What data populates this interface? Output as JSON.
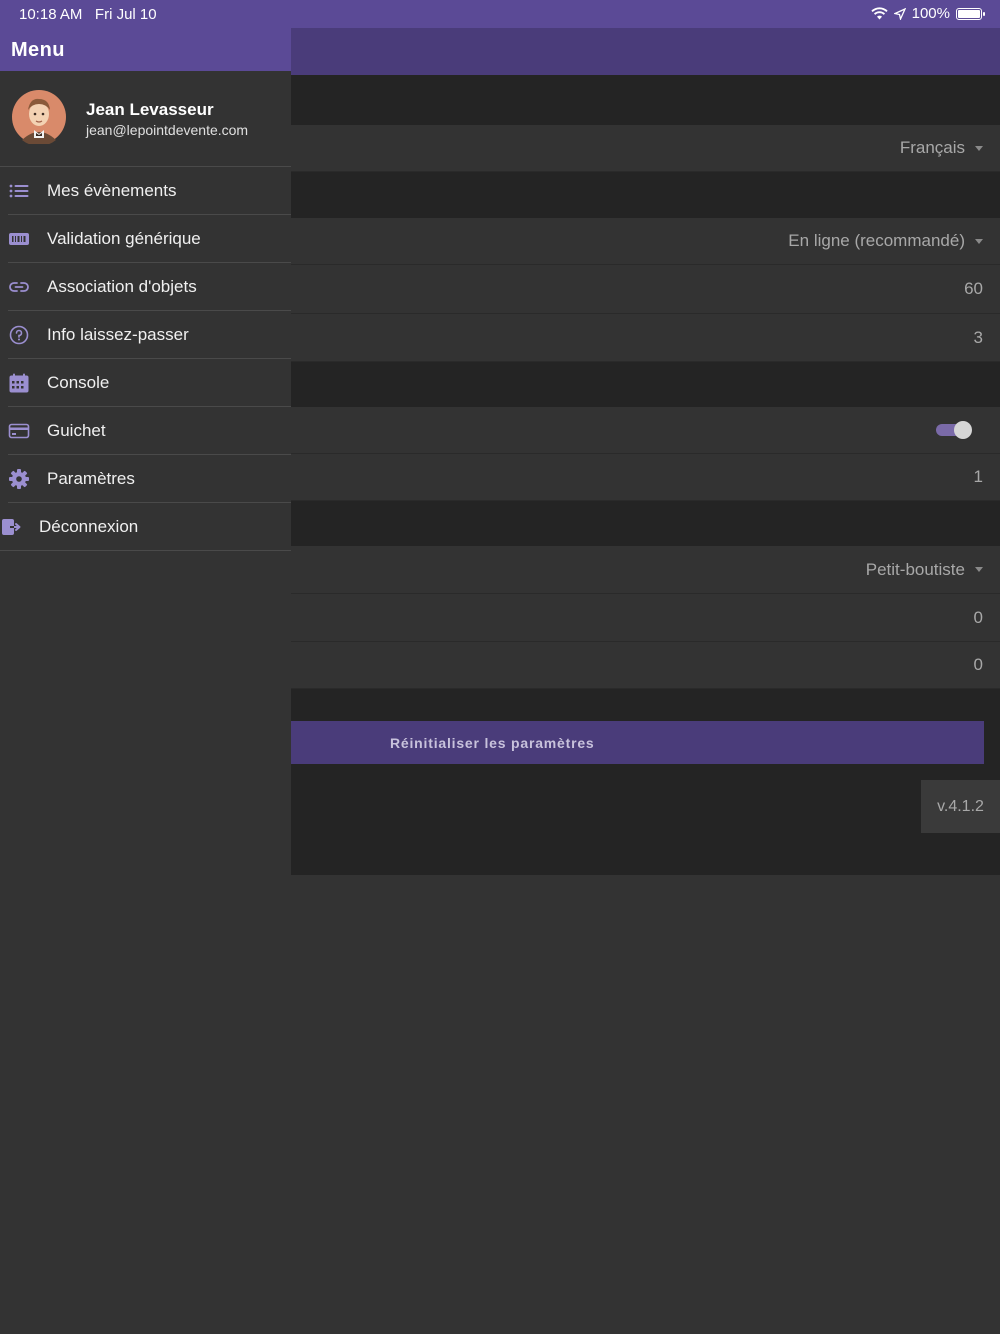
{
  "status_bar": {
    "time": "10:18 AM",
    "date": "Fri Jul 10",
    "battery": "100%"
  },
  "drawer": {
    "title": "Menu",
    "user": {
      "name": "Jean Levasseur",
      "email": "jean@lepointdevente.com"
    },
    "items": [
      {
        "label": "Mes évènements",
        "icon": "list-icon"
      },
      {
        "label": "Validation générique",
        "icon": "barcode-icon"
      },
      {
        "label": "Association d'objets",
        "icon": "link-icon"
      },
      {
        "label": "Info laissez-passer",
        "icon": "question-circle-icon"
      },
      {
        "label": "Console",
        "icon": "calendar-icon"
      },
      {
        "label": "Guichet",
        "icon": "credit-card-icon"
      },
      {
        "label": "Paramètres",
        "icon": "gear-icon"
      },
      {
        "label": "Déconnexion",
        "icon": "logout-icon"
      }
    ]
  },
  "settings": {
    "language": "Français",
    "mode": "En ligne (recommandé)",
    "value_60": "60",
    "value_3": "3",
    "toggle_on": true,
    "value_1": "1",
    "byte_order": "Petit-boutiste",
    "value_0a": "0",
    "value_0b": "0",
    "reset_label": "Réinitialiser les paramètres",
    "version": "v.4.1.2"
  },
  "colors": {
    "accent": "#5b4a96",
    "accent_dimmed": "#4a3c7a",
    "background": "#333333",
    "icon": "#9b8fd0"
  }
}
